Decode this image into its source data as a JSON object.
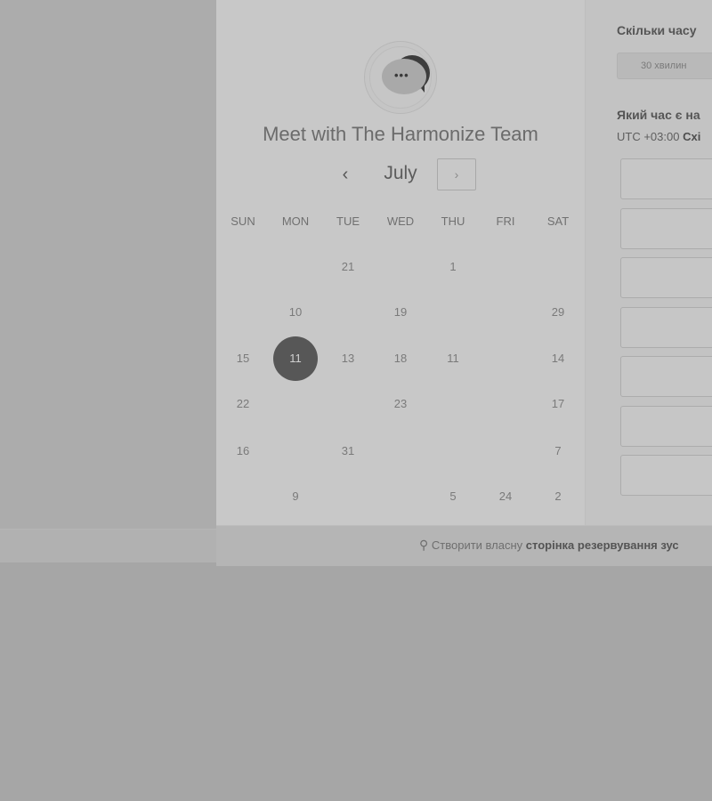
{
  "scheduler": {
    "title": "Meet with The Harmonize Team",
    "month": "July",
    "prev_arrow": "‹",
    "next_arrow": "›",
    "weekdays": [
      "SUN",
      "MON",
      "TUE",
      "WED",
      "THU",
      "FRI",
      "SAT"
    ],
    "days": [
      {
        "label": "21",
        "col": 2,
        "row": 0
      },
      {
        "label": "1",
        "col": 4,
        "row": 0
      },
      {
        "label": "10",
        "col": 1,
        "row": 1
      },
      {
        "label": "19",
        "col": 3,
        "row": 1
      },
      {
        "label": "29",
        "col": 6,
        "row": 1
      },
      {
        "label": "15",
        "col": 0,
        "row": 2
      },
      {
        "label": "11",
        "col": 1,
        "row": 2,
        "selected": true
      },
      {
        "label": "13",
        "col": 2,
        "row": 2
      },
      {
        "label": "18",
        "col": 3,
        "row": 2
      },
      {
        "label": "11",
        "col": 4,
        "row": 2
      },
      {
        "label": "14",
        "col": 6,
        "row": 2
      },
      {
        "label": "22",
        "col": 0,
        "row": 3
      },
      {
        "label": "23",
        "col": 3,
        "row": 3
      },
      {
        "label": "17",
        "col": 6,
        "row": 3
      },
      {
        "label": "16",
        "col": 0,
        "row": 4
      },
      {
        "label": "31",
        "col": 2,
        "row": 4
      },
      {
        "label": "7",
        "col": 6,
        "row": 4
      },
      {
        "label": "9",
        "col": 1,
        "row": 5
      },
      {
        "label": "5",
        "col": 4,
        "row": 5
      },
      {
        "label": "24",
        "col": 5,
        "row": 5
      },
      {
        "label": "2",
        "col": 6,
        "row": 5
      }
    ]
  },
  "side": {
    "duration_question": "Скільки часу",
    "duration_option": "30 хвилин",
    "time_question": "Який час є на",
    "tz_prefix": "UTC +03:00",
    "tz_name": "Схі",
    "slot_count": 7
  },
  "footer": {
    "icon": "hubspot-sprocket-icon",
    "text_prefix": "Створити власну",
    "text_bold": "сторінка резервування зус"
  },
  "colors": {
    "overlay_gray": "#acacac",
    "selected_day": "#575757"
  }
}
